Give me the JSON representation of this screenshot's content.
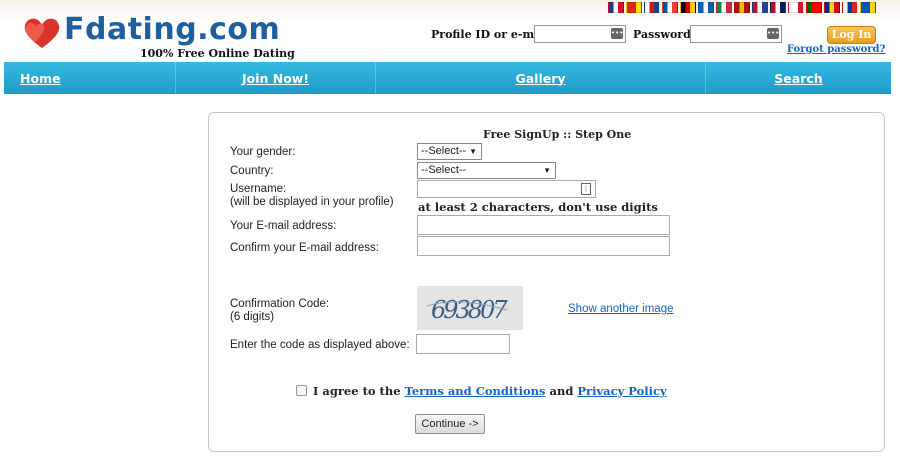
{
  "brand": {
    "logo_text": "Fdating.com",
    "tagline": "100% Free Online Dating"
  },
  "header": {
    "flags": [
      {
        "name": "uk-flag",
        "colors": [
          "#1f3b8a",
          "#ffffff",
          "#cf142b"
        ]
      },
      {
        "name": "china-flag",
        "colors": [
          "#de2910",
          "#de2910",
          "#ffde00"
        ]
      },
      {
        "name": "czech-flag",
        "colors": [
          "#ffffff",
          "#d7141a",
          "#11457e"
        ]
      },
      {
        "name": "france-flag",
        "colors": [
          "#0055a4",
          "#ffffff",
          "#ef4135"
        ]
      },
      {
        "name": "germany-flag",
        "colors": [
          "#000000",
          "#dd0000",
          "#ffce00"
        ]
      },
      {
        "name": "greece-flag",
        "colors": [
          "#0d5eaf",
          "#ffffff",
          "#0d5eaf"
        ]
      },
      {
        "name": "italy-flag",
        "colors": [
          "#009246",
          "#ffffff",
          "#ce2b37"
        ]
      },
      {
        "name": "spain-flag",
        "colors": [
          "#aa151b",
          "#f1bf00",
          "#aa151b"
        ]
      },
      {
        "name": "netherlands-flag",
        "colors": [
          "#ae1c28",
          "#ffffff",
          "#21468b"
        ]
      },
      {
        "name": "norway-flag",
        "colors": [
          "#ba0c2f",
          "#ffffff",
          "#00205b"
        ]
      },
      {
        "name": "poland-flag",
        "colors": [
          "#ffffff",
          "#ffffff",
          "#dc143c"
        ]
      },
      {
        "name": "portugal-flag",
        "colors": [
          "#006600",
          "#ff0000",
          "#ff0000"
        ]
      },
      {
        "name": "romania-flag",
        "colors": [
          "#002b7f",
          "#fcd116",
          "#ce1126"
        ]
      },
      {
        "name": "russia-flag",
        "colors": [
          "#ffffff",
          "#0039a6",
          "#d52b1e"
        ]
      },
      {
        "name": "ukraine-flag",
        "colors": [
          "#0057b7",
          "#0057b7",
          "#ffd700"
        ]
      }
    ],
    "login": {
      "profile_label": "Profile ID or e-mail:",
      "password_label": "Password:",
      "button": "Log In",
      "forgot": "Forgot password?"
    }
  },
  "nav": [
    {
      "label": "Home",
      "name": "nav-home"
    },
    {
      "label": "Join Now!",
      "name": "nav-join-now"
    },
    {
      "label": "Gallery",
      "name": "nav-gallery"
    },
    {
      "label": "Search",
      "name": "nav-search"
    }
  ],
  "form": {
    "title": "Free SignUp :: Step One",
    "gender_label": "Your gender:",
    "gender_value": "--Select--",
    "country_label": "Country:",
    "country_value": "--Select--",
    "username_label": "Username:",
    "username_sub": "(will be displayed in your profile)",
    "username_hint": "at least 2 characters, don't use digits",
    "email_label": "Your E-mail address:",
    "email_confirm_label": "Confirm your E-mail address:",
    "captcha_label": "Confirmation Code:",
    "captcha_sub": "(6 digits)",
    "captcha_text": "693807",
    "show_another": "Show another image",
    "enter_code_label": "Enter the code as displayed above:",
    "agree_prefix": "I agree to the",
    "terms": "Terms and Conditions",
    "and": "and",
    "privacy": "Privacy Policy",
    "continue": "Continue ->"
  },
  "colors": {
    "brand_blue": "#1f5f9e",
    "nav_blue": "#29aad8",
    "link_blue": "#1565c0",
    "login_orange": "#f0a928"
  }
}
